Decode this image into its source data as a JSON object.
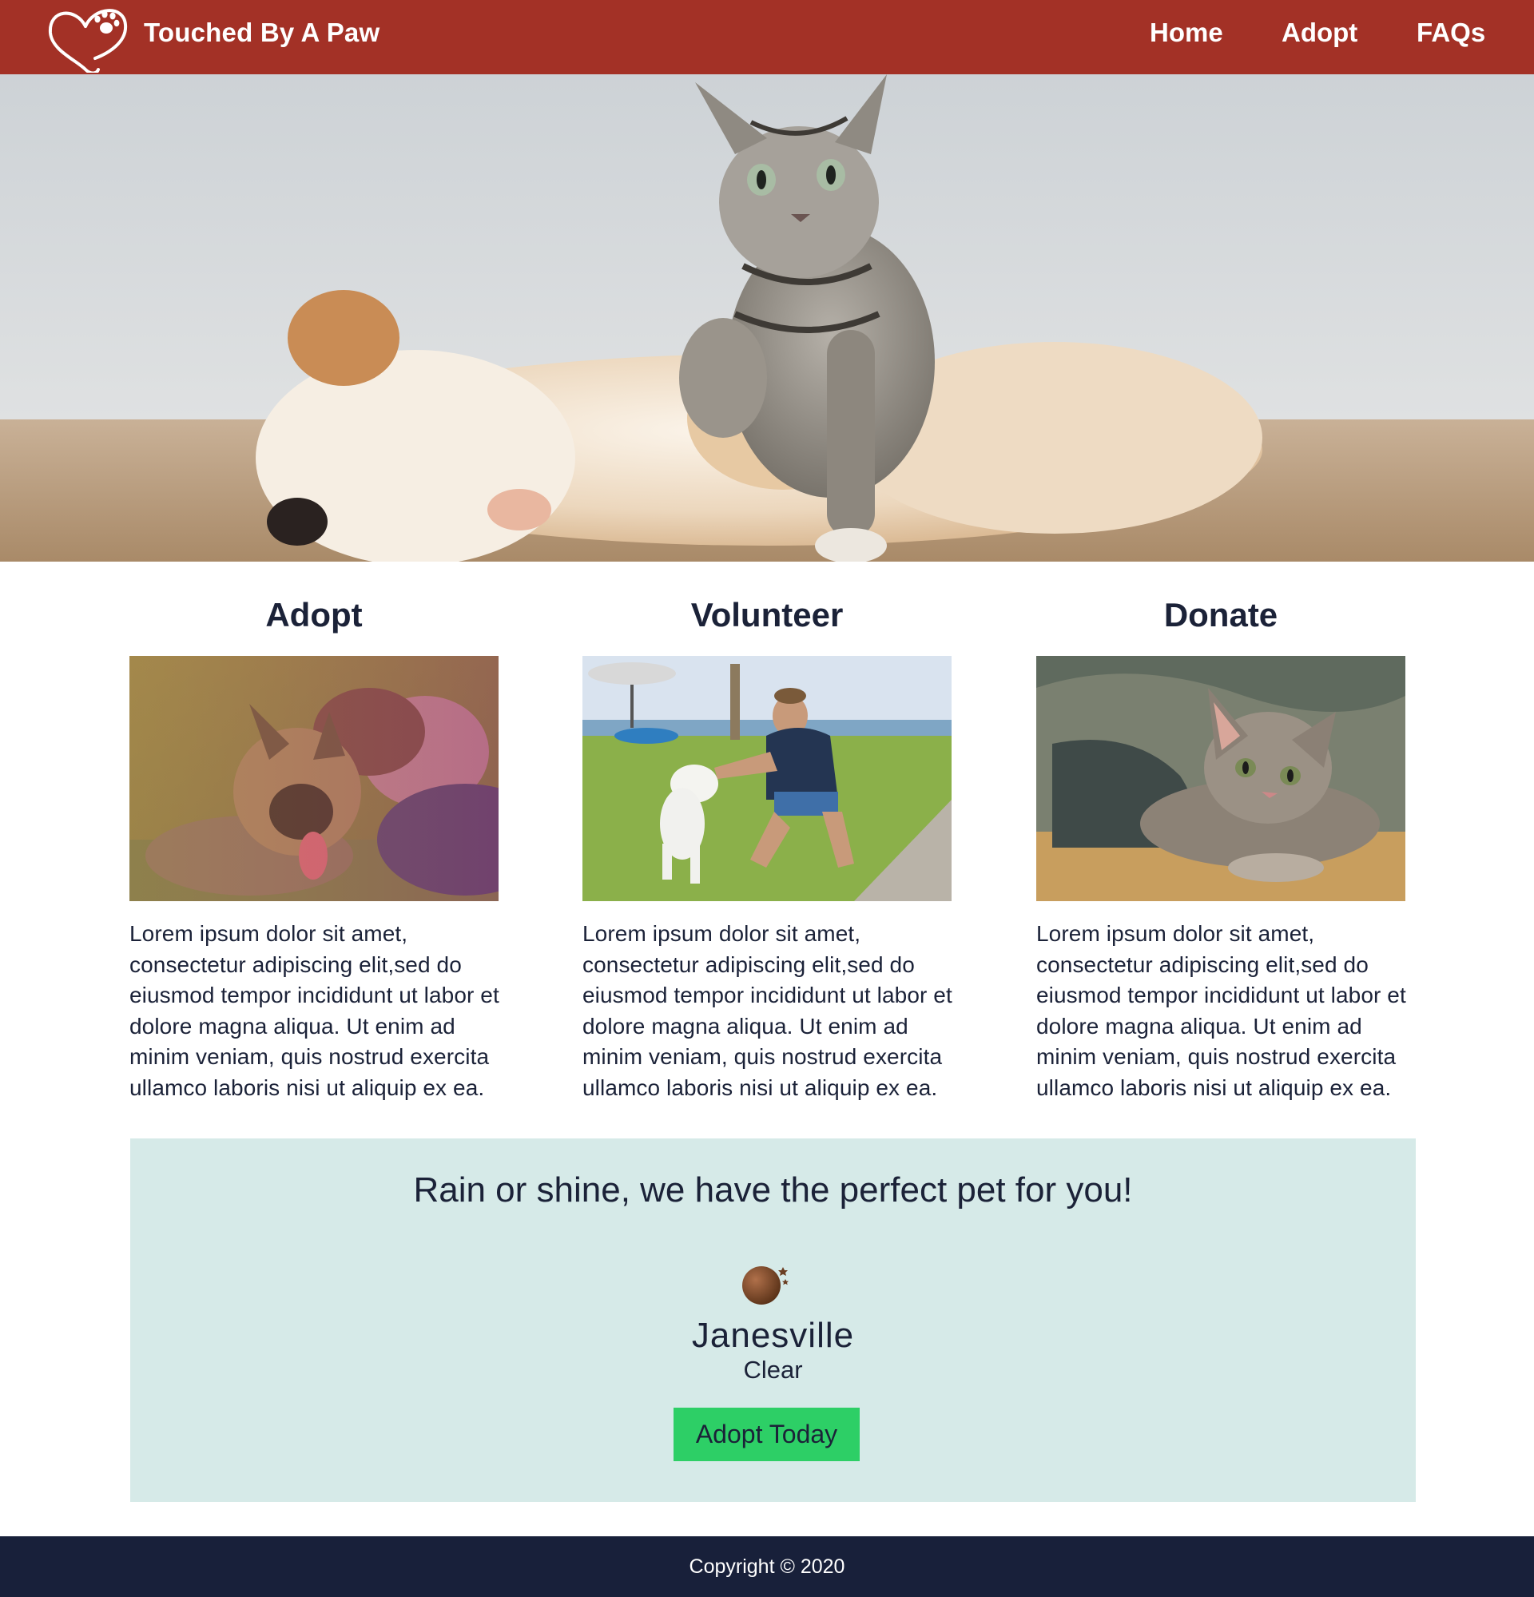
{
  "header": {
    "brand": "Touched By A Paw",
    "nav": [
      "Home",
      "Adopt",
      "FAQs"
    ],
    "logo_icon": "heart-paw-icon"
  },
  "hero": {
    "image": "puppy-and-kitten-photo"
  },
  "cards": [
    {
      "title": "Adopt",
      "image": "girl-hugging-german-shepherd-photo",
      "text": "Lorem ipsum dolor sit amet, consectetur adipiscing elit,sed do eiusmod tempor incididunt ut labor et dolore magna aliqua. Ut enim ad minim veniam, quis nostrud exercita ullamco laboris nisi ut aliquip ex ea."
    },
    {
      "title": "Volunteer",
      "image": "man-playing-with-white-puppy-photo",
      "text": "Lorem ipsum dolor sit amet, consectetur adipiscing elit,sed do eiusmod tempor incididunt ut labor et dolore magna aliqua. Ut enim ad minim veniam, quis nostrud exercita ullamco laboris nisi ut aliquip ex ea."
    },
    {
      "title": "Donate",
      "image": "tabby-kitten-on-blanket-photo",
      "text": "Lorem ipsum dolor sit amet, consectetur adipiscing elit,sed do eiusmod tempor incididunt ut labor et dolore magna aliqua. Ut enim ad minim veniam, quis nostrud exercita ullamco laboris nisi ut aliquip ex ea."
    }
  ],
  "weather": {
    "heading": "Rain or shine, we have the perfect pet for you!",
    "city": "Janesville",
    "condition": "Clear",
    "icon": "clear-night-moon-icon",
    "button": "Adopt Today"
  },
  "footer": {
    "copyright": "Copyright © 2020"
  },
  "colors": {
    "header": "#a33126",
    "panel": "#d6eae8",
    "button": "#2dcf66",
    "footer": "#18203a",
    "text": "#1b2238"
  }
}
